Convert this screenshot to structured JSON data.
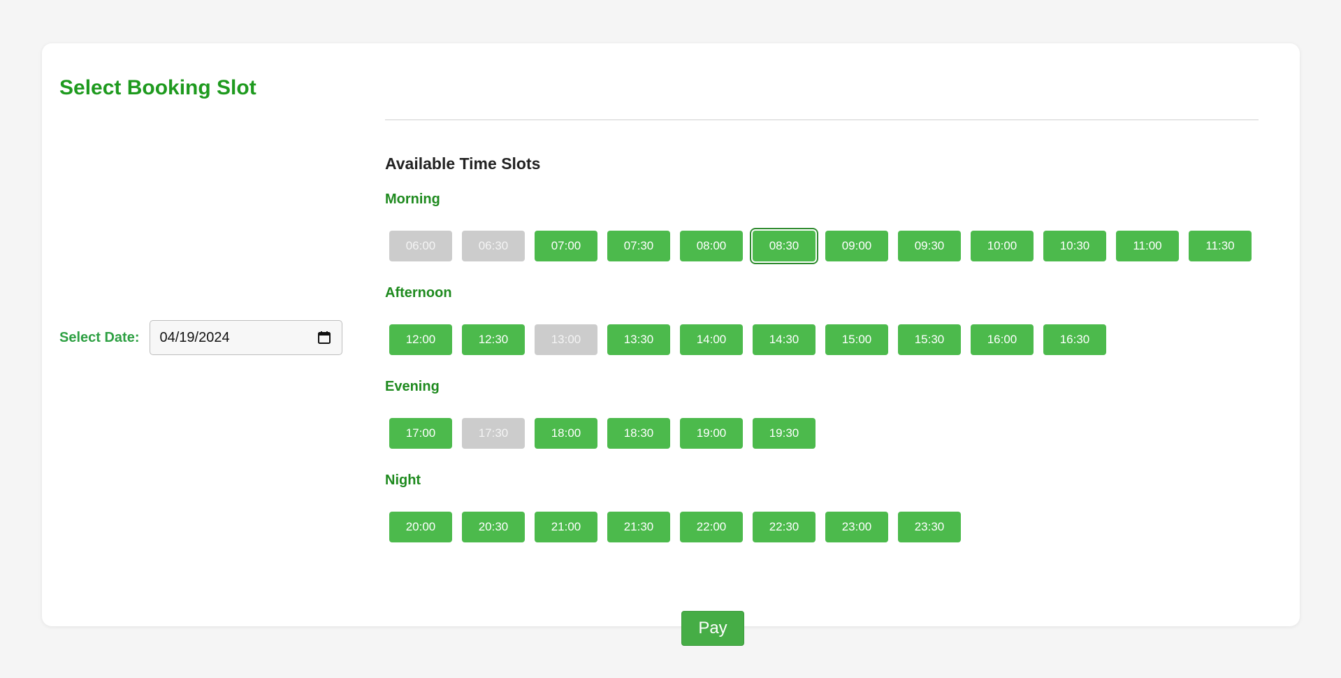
{
  "page": {
    "title": "Select Booking Slot"
  },
  "date": {
    "label": "Select Date:",
    "value": "04/19/2024"
  },
  "slots": {
    "heading": "Available Time Slots",
    "groups": [
      {
        "name": "Morning",
        "slots": [
          {
            "time": "06:00",
            "state": "disabled"
          },
          {
            "time": "06:30",
            "state": "disabled"
          },
          {
            "time": "07:00",
            "state": "available"
          },
          {
            "time": "07:30",
            "state": "available"
          },
          {
            "time": "08:00",
            "state": "available"
          },
          {
            "time": "08:30",
            "state": "selected"
          },
          {
            "time": "09:00",
            "state": "available"
          },
          {
            "time": "09:30",
            "state": "available"
          },
          {
            "time": "10:00",
            "state": "available"
          },
          {
            "time": "10:30",
            "state": "available"
          },
          {
            "time": "11:00",
            "state": "available"
          },
          {
            "time": "11:30",
            "state": "available"
          }
        ]
      },
      {
        "name": "Afternoon",
        "slots": [
          {
            "time": "12:00",
            "state": "available"
          },
          {
            "time": "12:30",
            "state": "available"
          },
          {
            "time": "13:00",
            "state": "disabled"
          },
          {
            "time": "13:30",
            "state": "available"
          },
          {
            "time": "14:00",
            "state": "available"
          },
          {
            "time": "14:30",
            "state": "available"
          },
          {
            "time": "15:00",
            "state": "available"
          },
          {
            "time": "15:30",
            "state": "available"
          },
          {
            "time": "16:00",
            "state": "available"
          },
          {
            "time": "16:30",
            "state": "available"
          }
        ]
      },
      {
        "name": "Evening",
        "slots": [
          {
            "time": "17:00",
            "state": "available"
          },
          {
            "time": "17:30",
            "state": "disabled"
          },
          {
            "time": "18:00",
            "state": "available"
          },
          {
            "time": "18:30",
            "state": "available"
          },
          {
            "time": "19:00",
            "state": "available"
          },
          {
            "time": "19:30",
            "state": "available"
          }
        ]
      },
      {
        "name": "Night",
        "slots": [
          {
            "time": "20:00",
            "state": "available"
          },
          {
            "time": "20:30",
            "state": "available"
          },
          {
            "time": "21:00",
            "state": "available"
          },
          {
            "time": "21:30",
            "state": "available"
          },
          {
            "time": "22:00",
            "state": "available"
          },
          {
            "time": "22:30",
            "state": "available"
          },
          {
            "time": "23:00",
            "state": "available"
          },
          {
            "time": "23:30",
            "state": "available"
          }
        ]
      }
    ]
  },
  "actions": {
    "pay_label": "Pay"
  },
  "colors": {
    "title_green": "#1e9a1e",
    "slot_available": "#4cba4c",
    "slot_disabled": "#cccccc",
    "slot_selected_ring": "#2e8b2e",
    "pay_button": "#46ad46"
  },
  "icons": {
    "date_picker": "calendar-icon"
  }
}
